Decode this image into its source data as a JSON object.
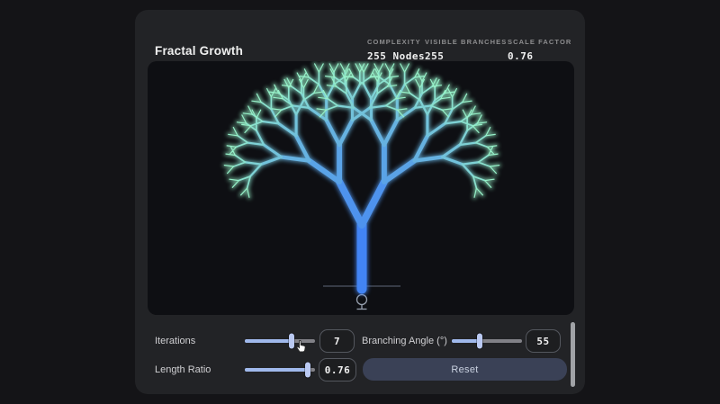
{
  "theme": {
    "bg": "#141417",
    "panel": "#222326",
    "canvas-bg": "#0e0f13",
    "text": "#f0f0f0",
    "muted": "#8d8d8f",
    "label": "#cfcfd2",
    "slider-track": "#818187",
    "slider-fill": "#a0b9ec",
    "slider-thumb": "#bac9f2",
    "box-border": "#54575e",
    "reset-bg": "#3a4156",
    "reset-text": "#c9d1e0",
    "scrollbar": "#a0a2a6",
    "ground-line": "#434a58",
    "tree-icon": "#97a0ae"
  },
  "header": {
    "title": "Fractal Growth",
    "stats": [
      {
        "label": "COMPLEXITY",
        "value": "255 Nodes"
      },
      {
        "label": "VISIBLE BRANCHES",
        "value": "255"
      },
      {
        "label": "SCALE FACTOR",
        "value": "0.76"
      }
    ]
  },
  "fractal": {
    "iterations": 7,
    "branching_angle_deg": 55,
    "length_ratio": 0.76,
    "trunk_color": "#4284f4",
    "tip_color": "#96f0c8"
  },
  "controls": {
    "iterations": {
      "label": "Iterations",
      "value": "7",
      "fill_pct": 67
    },
    "branching_angle": {
      "label": "Branching Angle (°)",
      "value": "55",
      "fill_pct": 40
    },
    "length_ratio": {
      "label": "Length Ratio",
      "value": "0.76",
      "fill_pct": 90
    },
    "reset_label": "Reset"
  }
}
